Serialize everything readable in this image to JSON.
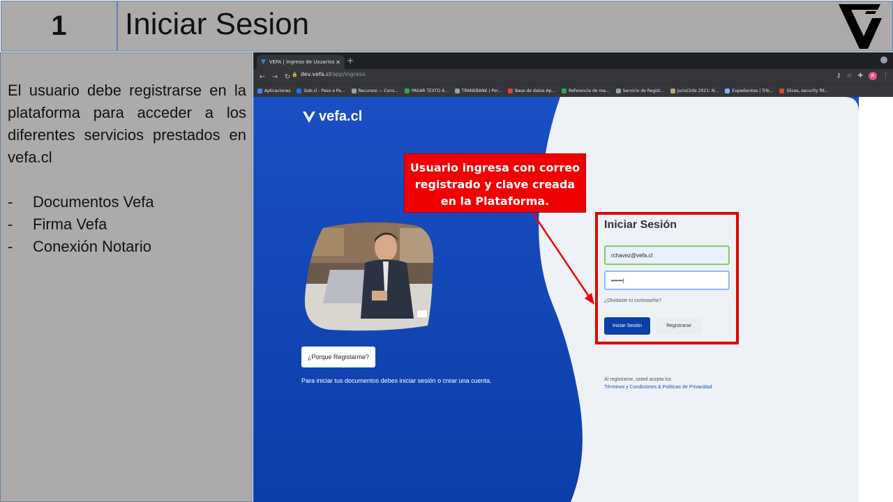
{
  "header": {
    "number": "1",
    "title": "Iniciar Sesion"
  },
  "left_panel": {
    "description": "El usuario debe registrarse en la plataforma para acceder a los diferentes servicios prestados en vefa.cl",
    "bullets": [
      "Documentos Vefa",
      "Firma Vefa",
      "Conexión Notario"
    ]
  },
  "browser": {
    "tab_title": "VEFA | Ingreso de Usuarios",
    "url_host": "dev.vefa.cl",
    "url_path": "/app/ingreso",
    "avatar_letter": "R",
    "bookmarks": [
      {
        "label": "Aplicaciones",
        "color": "#4285f4"
      },
      {
        "label": "Gob.cl - Paso a Pa...",
        "color": "#1a73e8"
      },
      {
        "label": "Recursos — Cons...",
        "color": "#9aa0a6"
      },
      {
        "label": "PASAR TEXTO A...",
        "color": "#34a853"
      },
      {
        "label": "TRANSBANK | Por...",
        "color": "#9aa0a6"
      },
      {
        "label": "Base de datos Ap...",
        "color": "#ea4335"
      },
      {
        "label": "Referencia de ma...",
        "color": "#34a853"
      },
      {
        "label": "Servicio de Regist...",
        "color": "#9aa0a6"
      },
      {
        "label": "JurisChile 2021: N...",
        "color": "#c5a46d"
      },
      {
        "label": "Expedientes | Trib...",
        "color": "#8ab4f8"
      },
      {
        "label": "Slices, security filt...",
        "color": "#ea4335"
      }
    ]
  },
  "page": {
    "brand": "vefa.cl",
    "why_button": "¿Porque Registarme?",
    "start_note": "Para iniciar tus documentos debes iniciar sesión o crear una cuenta.",
    "login_title": "Iniciar Sesión",
    "email_value": "rchavez@vefa.cl",
    "password_value": "••••••|",
    "forgot_link": "¿Olvidaste tu contraseña?",
    "login_button": "Iniciar Sesión",
    "register_button": "Registrarse",
    "terms_prefix": "Al registrarse, usted acepta los",
    "terms_link": "Términos y Condiciones & Políticas de Privacidad"
  },
  "callout": {
    "line1": "Usuario ingresa con correo",
    "line2": "registrado y clave creada",
    "line3": "en la Plataforma."
  },
  "colors": {
    "accent_red": "#f00000",
    "brand_blue": "#0a3fa8",
    "slide_gray": "#adabaa"
  }
}
